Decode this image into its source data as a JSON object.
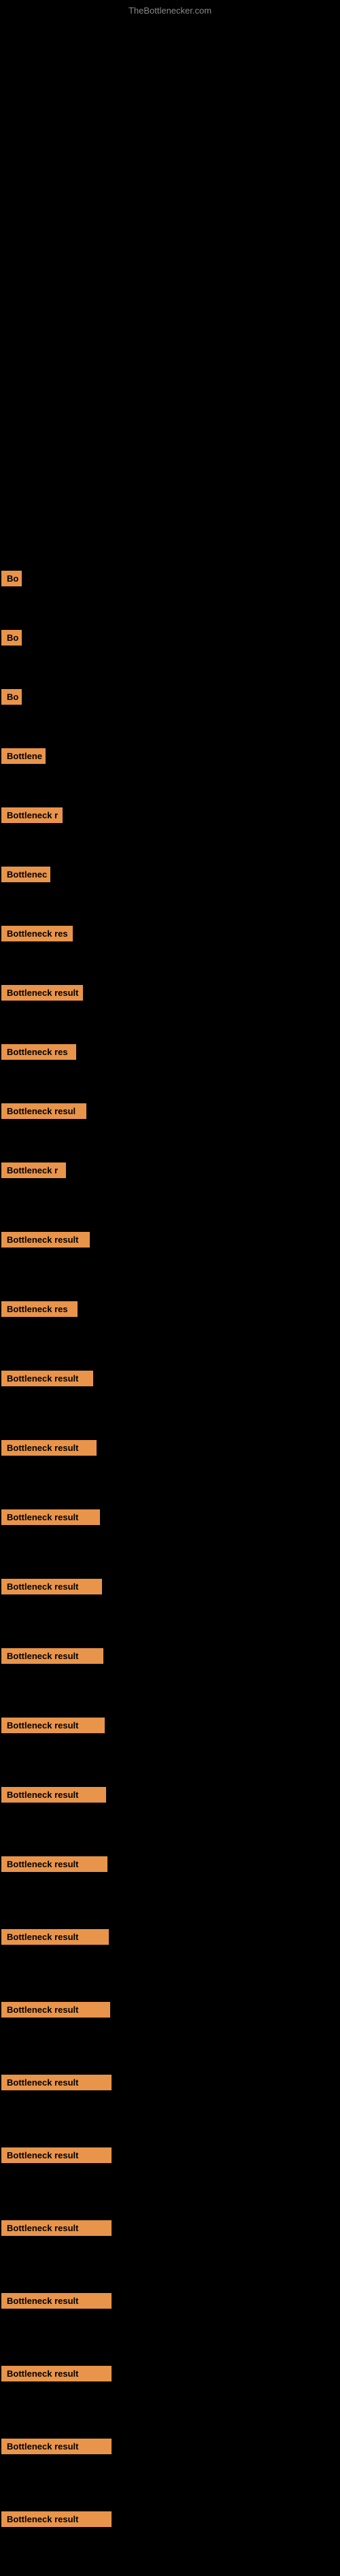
{
  "site": {
    "title": "TheBottlenecker.com"
  },
  "items": [
    {
      "id": 1,
      "label": "Bo",
      "width": 30
    },
    {
      "id": 2,
      "label": "Bo",
      "width": 30
    },
    {
      "id": 3,
      "label": "Bo",
      "width": 30
    },
    {
      "id": 4,
      "label": "Bottlene",
      "width": 65
    },
    {
      "id": 5,
      "label": "Bottleneck r",
      "width": 90
    },
    {
      "id": 6,
      "label": "Bottlenec",
      "width": 72
    },
    {
      "id": 7,
      "label": "Bottleneck res",
      "width": 105
    },
    {
      "id": 8,
      "label": "Bottleneck result",
      "width": 120
    },
    {
      "id": 9,
      "label": "Bottleneck res",
      "width": 110
    },
    {
      "id": 10,
      "label": "Bottleneck resul",
      "width": 125
    },
    {
      "id": 11,
      "label": "Bottleneck r",
      "width": 95
    },
    {
      "id": 12,
      "label": "Bottleneck result",
      "width": 130
    },
    {
      "id": 13,
      "label": "Bottleneck res",
      "width": 112
    },
    {
      "id": 14,
      "label": "Bottleneck result",
      "width": 135
    },
    {
      "id": 15,
      "label": "Bottleneck result",
      "width": 140
    },
    {
      "id": 16,
      "label": "Bottleneck result",
      "width": 145
    },
    {
      "id": 17,
      "label": "Bottleneck result",
      "width": 148
    },
    {
      "id": 18,
      "label": "Bottleneck result",
      "width": 150
    },
    {
      "id": 19,
      "label": "Bottleneck result",
      "width": 152
    },
    {
      "id": 20,
      "label": "Bottleneck result",
      "width": 154
    },
    {
      "id": 21,
      "label": "Bottleneck result",
      "width": 156
    },
    {
      "id": 22,
      "label": "Bottleneck result",
      "width": 158
    },
    {
      "id": 23,
      "label": "Bottleneck result",
      "width": 160
    },
    {
      "id": 24,
      "label": "Bottleneck result",
      "width": 162
    },
    {
      "id": 25,
      "label": "Bottleneck result",
      "width": 162
    },
    {
      "id": 26,
      "label": "Bottleneck result",
      "width": 162
    },
    {
      "id": 27,
      "label": "Bottleneck result",
      "width": 162
    },
    {
      "id": 28,
      "label": "Bottleneck result",
      "width": 162
    },
    {
      "id": 29,
      "label": "Bottleneck result",
      "width": 162
    },
    {
      "id": 30,
      "label": "Bottleneck result",
      "width": 162
    }
  ]
}
